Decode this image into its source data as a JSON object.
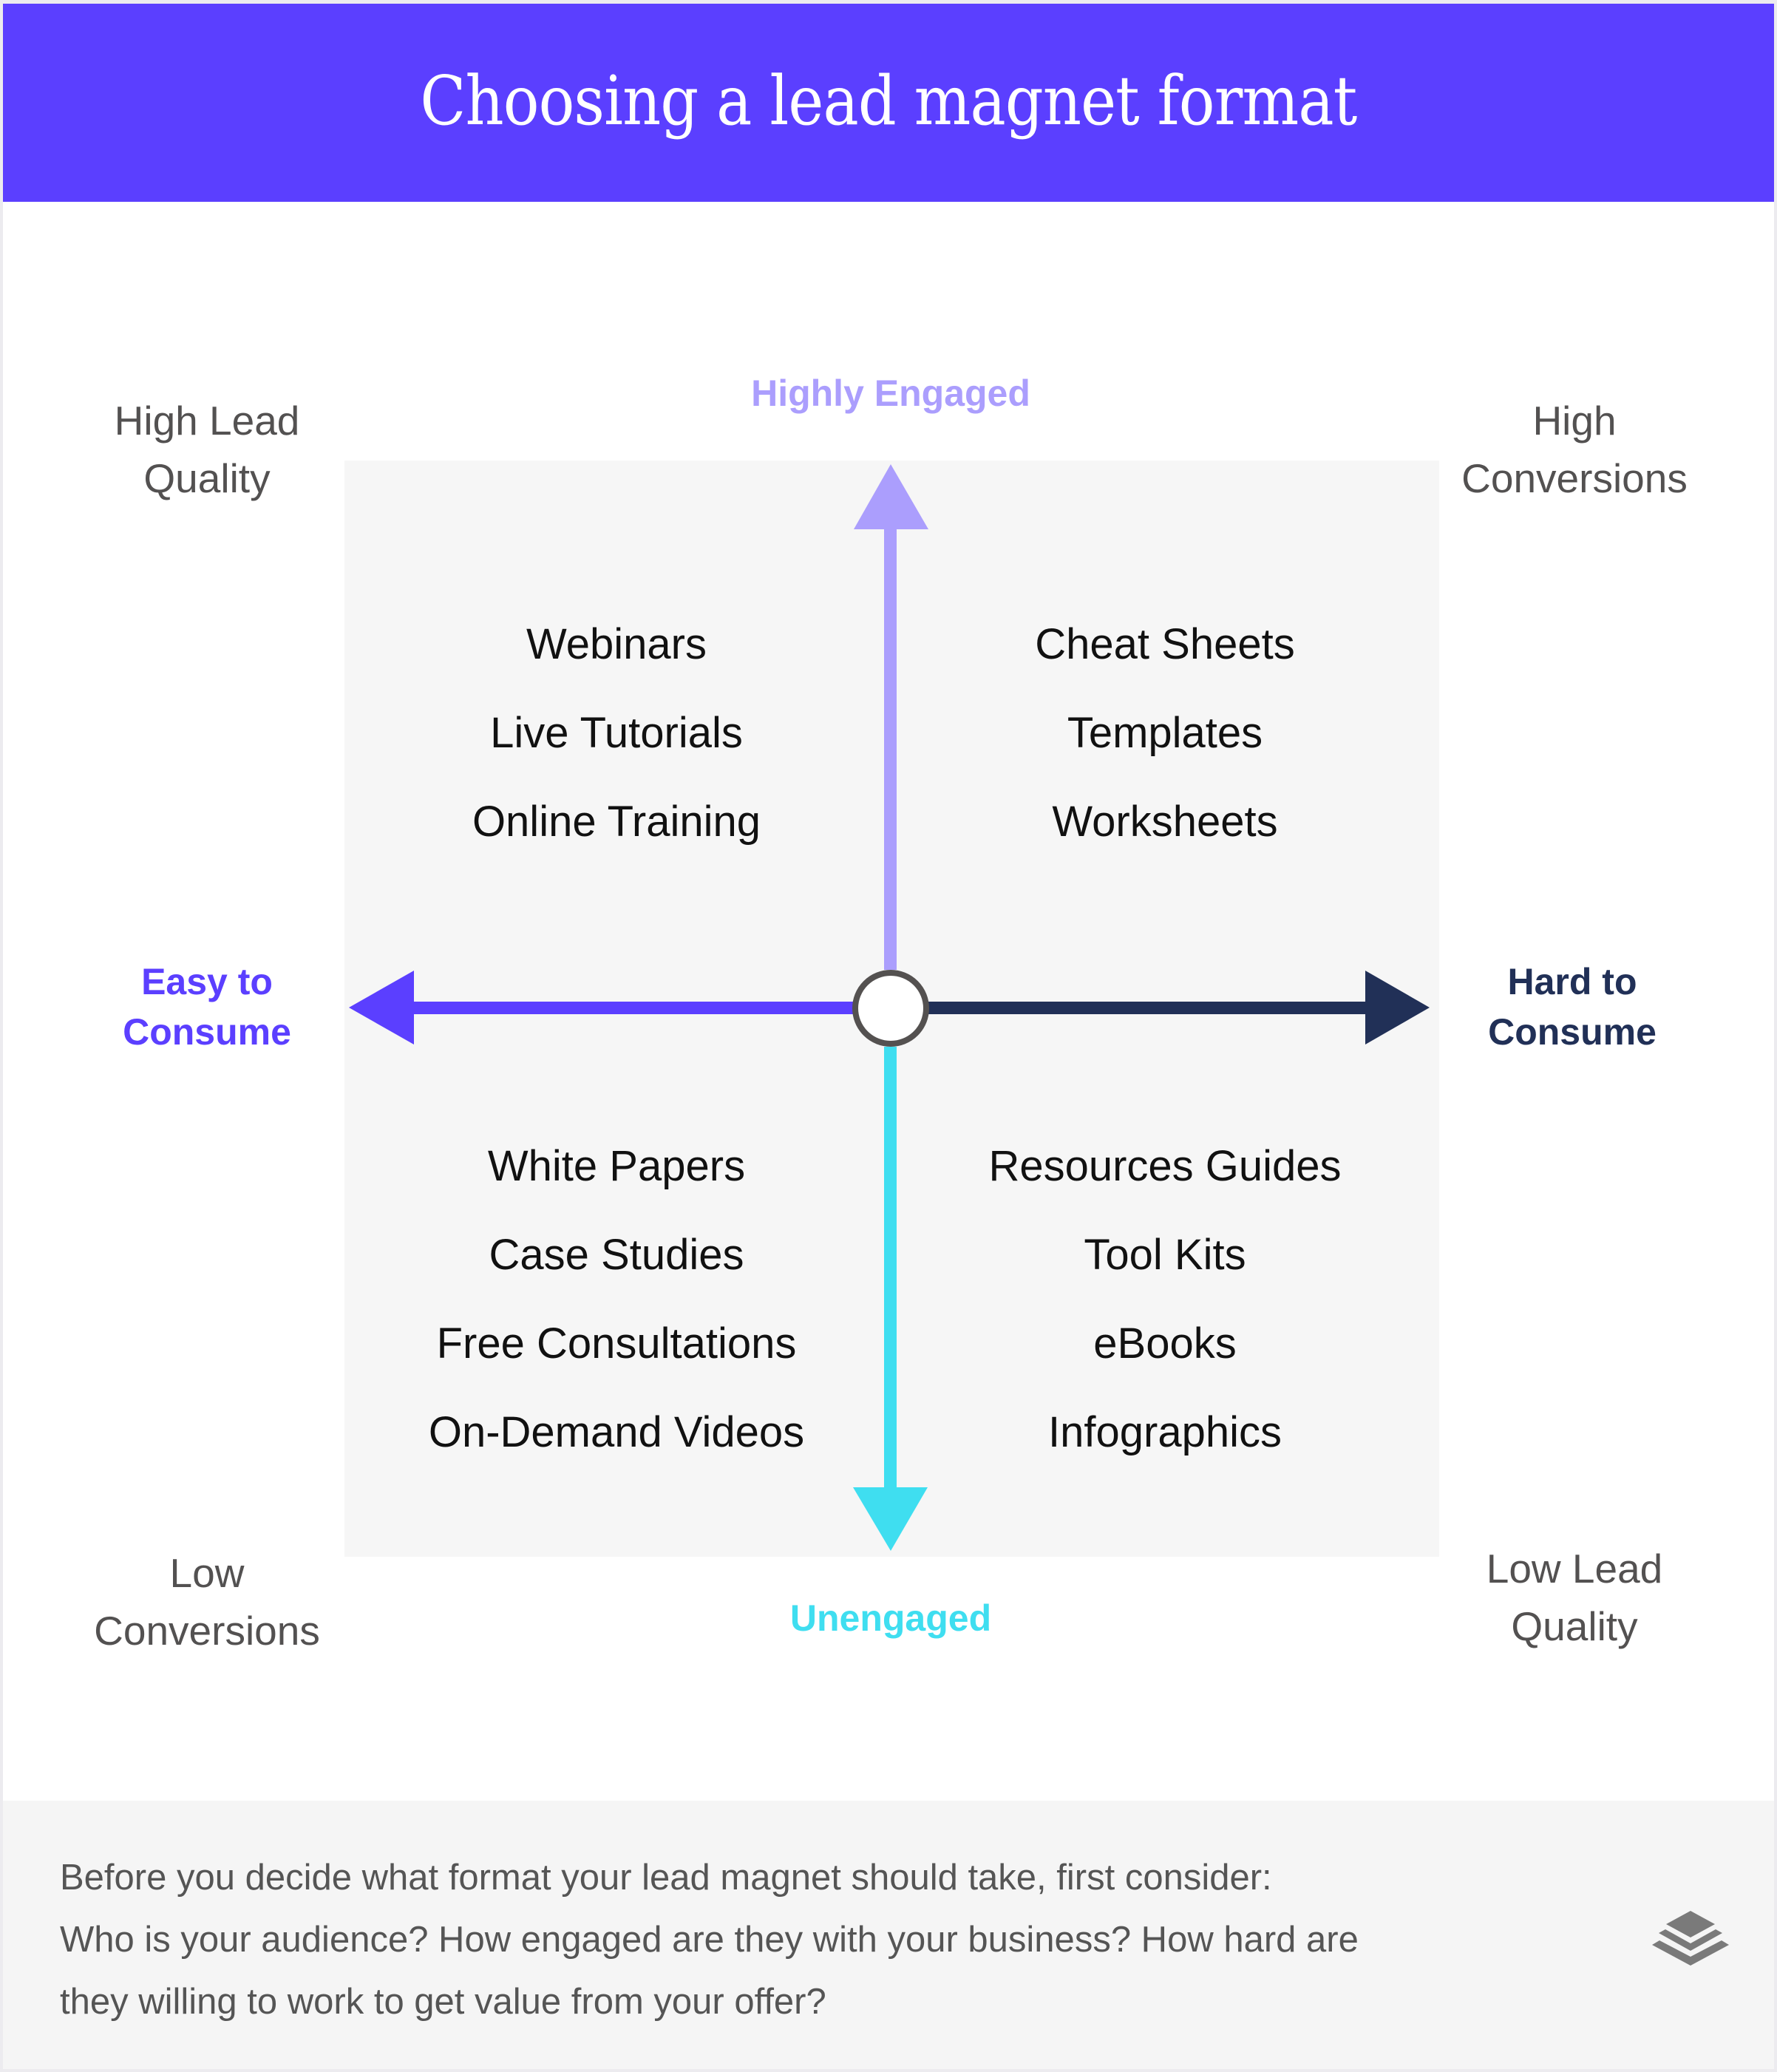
{
  "header": {
    "title": "Choosing a lead magnet format"
  },
  "colors": {
    "header_bg": "#5b3fff",
    "engaged": "#ab9efd",
    "unengaged": "#3fdef0",
    "easy": "#5b3fff",
    "hard": "#213057",
    "corner_text": "#535151",
    "item_text": "#111111",
    "quadrant_bg": "#f6f6f6"
  },
  "axes": {
    "top": "Highly Engaged",
    "bottom": "Unengaged",
    "left": {
      "line1": "Easy to",
      "line2": "Consume"
    },
    "right": {
      "line1": "Hard to",
      "line2": "Consume"
    }
  },
  "corners": {
    "top_left": {
      "line1": "High Lead",
      "line2": "Quality"
    },
    "top_right": {
      "line1": "High",
      "line2": "Conversions"
    },
    "bottom_left": {
      "line1": "Low",
      "line2": "Conversions"
    },
    "bottom_right": {
      "line1": "Low Lead",
      "line2": "Quality"
    }
  },
  "quadrants": {
    "top_left": [
      "Webinars",
      "Live Tutorials",
      "Online Training"
    ],
    "top_right": [
      "Cheat Sheets",
      "Templates",
      "Worksheets"
    ],
    "bottom_left": [
      "White Papers",
      "Case Studies",
      "Free Consultations",
      "On-Demand Videos"
    ],
    "bottom_right": [
      "Resources Guides",
      "Tool Kits",
      "eBooks",
      "Infographics"
    ]
  },
  "footer": {
    "lines": [
      "Before you decide what format your lead magnet should take, first consider:",
      "Who is your audience? How engaged are they with your business? How hard are",
      "they willing to work to get value from your offer?"
    ],
    "icon": "layers-icon"
  }
}
